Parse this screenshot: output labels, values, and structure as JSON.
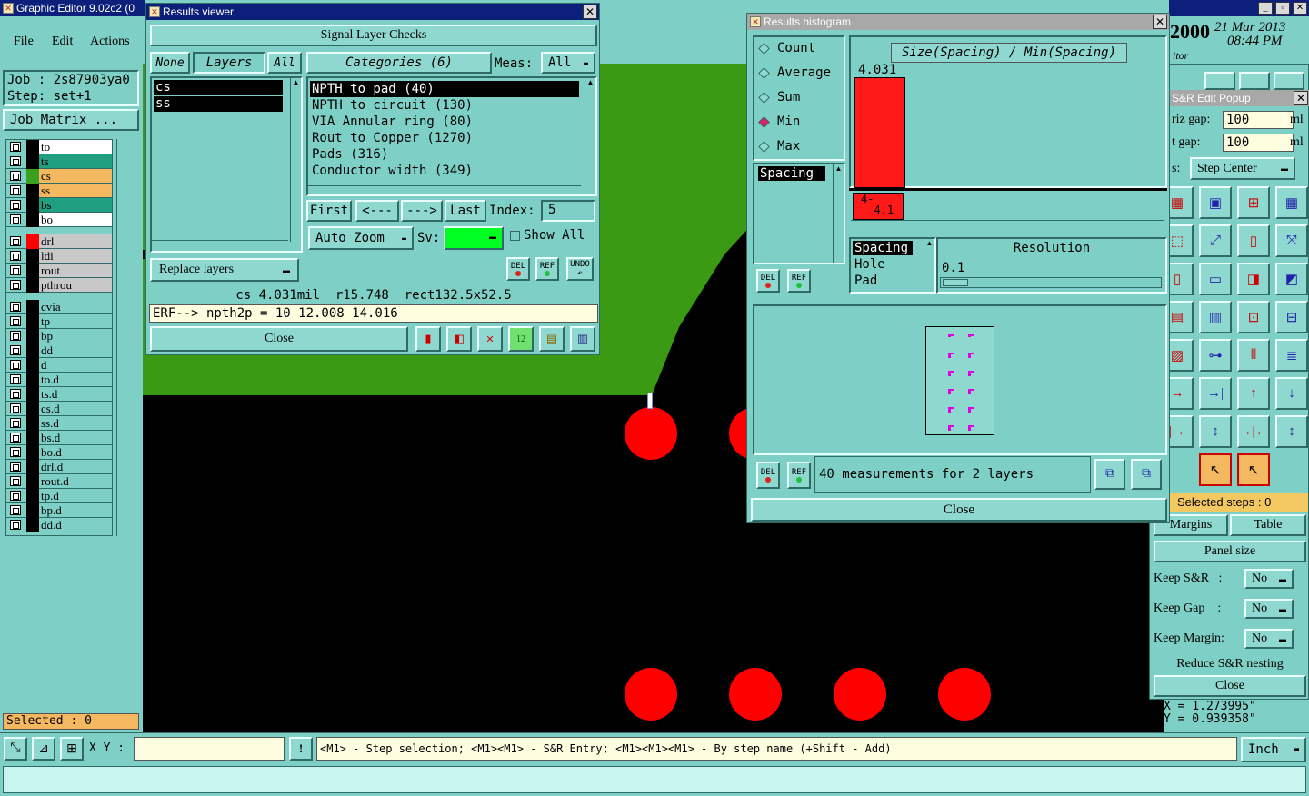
{
  "app": {
    "title": "Graphic Editor 9.02c2 (0"
  },
  "menu": {
    "file": "File",
    "edit": "Edit",
    "actions": "Actions"
  },
  "job": {
    "job_label": "Job : 2s87903ya0",
    "step_label": "Step: set+1",
    "matrix_button": "Job Matrix ..."
  },
  "layers": [
    {
      "name": "to",
      "color": "#ffffff",
      "sw": "#000000"
    },
    {
      "name": "ts",
      "color": "#1f9e80",
      "sw": "#000000"
    },
    {
      "name": "cs",
      "color": "#f4b860",
      "sw": "#3aa020"
    },
    {
      "name": "ss",
      "color": "#f4b860",
      "sw": "#000000"
    },
    {
      "name": "bs",
      "color": "#1f9e80",
      "sw": "#000000"
    },
    {
      "name": "bo",
      "color": "#ffffff",
      "sw": "#000000"
    },
    {
      "name": "drl",
      "color": "#c8c8c8",
      "sw": "#ff0000"
    },
    {
      "name": "ldi",
      "color": "#c8c8c8",
      "sw": "#000000"
    },
    {
      "name": "rout",
      "color": "#c8c8c8",
      "sw": "#000000"
    },
    {
      "name": "pthrou",
      "color": "#c8c8c8",
      "sw": "#000000"
    },
    {
      "name": "cvia",
      "color": "#7ed0c6",
      "sw": "#000000"
    },
    {
      "name": "tp",
      "color": "#7ed0c6",
      "sw": "#000000"
    },
    {
      "name": "bp",
      "color": "#7ed0c6",
      "sw": "#000000"
    },
    {
      "name": "dd",
      "color": "#7ed0c6",
      "sw": "#000000"
    },
    {
      "name": "d",
      "color": "#7ed0c6",
      "sw": "#000000"
    },
    {
      "name": "to.d",
      "color": "#7ed0c6",
      "sw": "#000000"
    },
    {
      "name": "ts.d",
      "color": "#7ed0c6",
      "sw": "#000000"
    },
    {
      "name": "cs.d",
      "color": "#7ed0c6",
      "sw": "#000000"
    },
    {
      "name": "ss.d",
      "color": "#7ed0c6",
      "sw": "#000000"
    },
    {
      "name": "bs.d",
      "color": "#7ed0c6",
      "sw": "#000000"
    },
    {
      "name": "bo.d",
      "color": "#7ed0c6",
      "sw": "#000000"
    },
    {
      "name": "drl.d",
      "color": "#7ed0c6",
      "sw": "#000000"
    },
    {
      "name": "rout.d",
      "color": "#7ed0c6",
      "sw": "#000000"
    },
    {
      "name": "tp.d",
      "color": "#7ed0c6",
      "sw": "#000000"
    },
    {
      "name": "bp.d",
      "color": "#7ed0c6",
      "sw": "#000000"
    },
    {
      "name": "dd.d",
      "color": "#7ed0c6",
      "sw": "#000000"
    }
  ],
  "left_status": {
    "selected": "Selected : 0"
  },
  "results_viewer": {
    "title": "Results viewer",
    "header": "Signal Layer Checks",
    "none_btn": "None",
    "layers_label": "Layers",
    "all_btn": "All",
    "categories_label": "Categories (6)",
    "meas_label": "Meas:",
    "meas_value": "All",
    "layers_list": [
      "cs",
      "ss"
    ],
    "categories": [
      "NPTH to pad (40)",
      "NPTH to circuit (130)",
      "VIA Annular ring (80)",
      "Rout to Copper (1270)",
      "Pads (316)",
      "Conductor width (349)"
    ],
    "first": "First",
    "prev": "<---",
    "next": "--->",
    "last": "Last",
    "index_label": "Index:",
    "index_value": "5",
    "auto_zoom": "Auto Zoom",
    "sv_label": "Sv:",
    "show_all": "Show All",
    "replace_layers": "Replace layers",
    "del": "DEL",
    "ref": "REF",
    "undo": "UNDO",
    "info_line": "cs 4.031mil  r15.748  rect132.5x52.5",
    "error_line": "ERF--> npth2p = 10 12.008 14.016",
    "close": "Close"
  },
  "histogram": {
    "title": "Results histogram",
    "modes": [
      "Count",
      "Average",
      "Sum",
      "Min",
      "Max"
    ],
    "selected_mode": "Min",
    "left_list": [
      "Spacing"
    ],
    "chart_title": "Size(Spacing) / Min(Spacing)",
    "bar_value": "4.031",
    "range_label": "4-\n  4.1",
    "measure_list": [
      "Spacing",
      "Hole",
      "Pad"
    ],
    "resolution_label": "Resolution",
    "resolution_value": "0.1",
    "del": "DEL",
    "ref": "REF",
    "status": "40 measurements for 2 layers",
    "close": "Close"
  },
  "sr_popup": {
    "title": "S&R Edit Popup",
    "horiz_gap_label": "riz gap:",
    "horiz_gap_value": "100",
    "horiz_unit": "ml",
    "vert_gap_label": "t  gap:",
    "vert_gap_value": "100",
    "vert_unit": "ml",
    "step_label": "s:",
    "step_value": "Step Center",
    "selected_steps": "Selected steps : 0",
    "margins": "Margins",
    "table": "Table",
    "panel_size": "Panel size",
    "keep_sr_label": "Keep S&R   :",
    "keep_sr_value": "No",
    "keep_gap_label": "Keep Gap    :",
    "keep_gap_value": "No",
    "keep_margin_label": "Keep Margin:",
    "keep_margin_value": "No",
    "reduce": "Reduce S&R nesting",
    "close": "Close"
  },
  "date": {
    "year": "2000",
    "date": "21 Mar 2013",
    "time": "08:44 PM",
    "sub": "itor"
  },
  "coords": {
    "x": "X = 1.273995\"",
    "y": "Y = 0.939358\""
  },
  "bottom": {
    "xy_label": "X Y :",
    "xy_value": "",
    "message": "<M1> - Step selection; <M1><M1> - S&R Entry; <M1><M1><M1> - By step name (+Shift - Add)",
    "unit": "Inch"
  },
  "colors": {
    "canvas_green": "#3a9a14",
    "pad_red": "#ff0000",
    "panel": "#7ed0c6",
    "title_blue": "#0c1f7a"
  }
}
